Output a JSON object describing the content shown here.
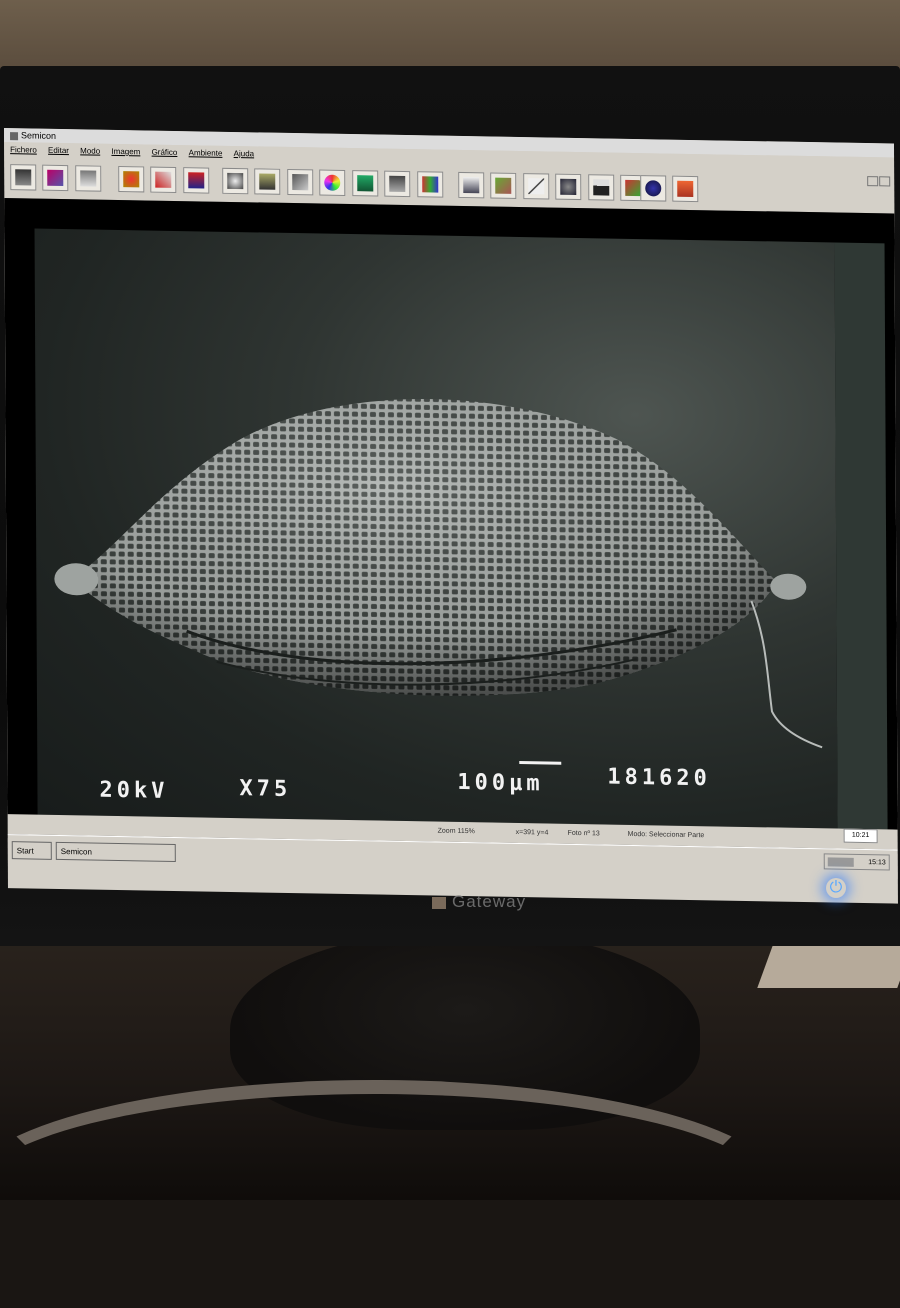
{
  "window": {
    "title": "Semicon"
  },
  "menu": [
    "Fichero",
    "Editar",
    "Modo",
    "Imagem",
    "Gráfico",
    "Ambiente",
    "Ajuda"
  ],
  "toolbar": {
    "group1": [
      "camera-icon",
      "open-image-icon",
      "print-icon"
    ],
    "group2": [
      "palette-icon",
      "tools-icon",
      "text-icon"
    ],
    "group3": [
      "zoom-icon",
      "chart-icon",
      "grid-icon",
      "color-wheel-icon"
    ],
    "group4": [
      "layers-icon",
      "stack-icon",
      "film-icon"
    ],
    "group5": [
      "select-icon",
      "measure-icon",
      "line-icon",
      "particles-icon",
      "histogram-icon",
      "export-icon"
    ],
    "group6": [
      "info-icon",
      "user-icon"
    ]
  },
  "sem": {
    "voltage": "20kV",
    "magnification": "X75",
    "scale": "100µm",
    "image_id": "181620"
  },
  "status": {
    "zoom": "Zoom 115%",
    "coords": "x=391 y=4",
    "photo": "Foto nº 13",
    "mode": "Modo: Seleccionar Parte",
    "time_box": "10:21"
  },
  "taskbar": {
    "start": "Start",
    "app": "Semicon",
    "clock": "15:13"
  },
  "monitor": {
    "brand": "Gateway"
  }
}
